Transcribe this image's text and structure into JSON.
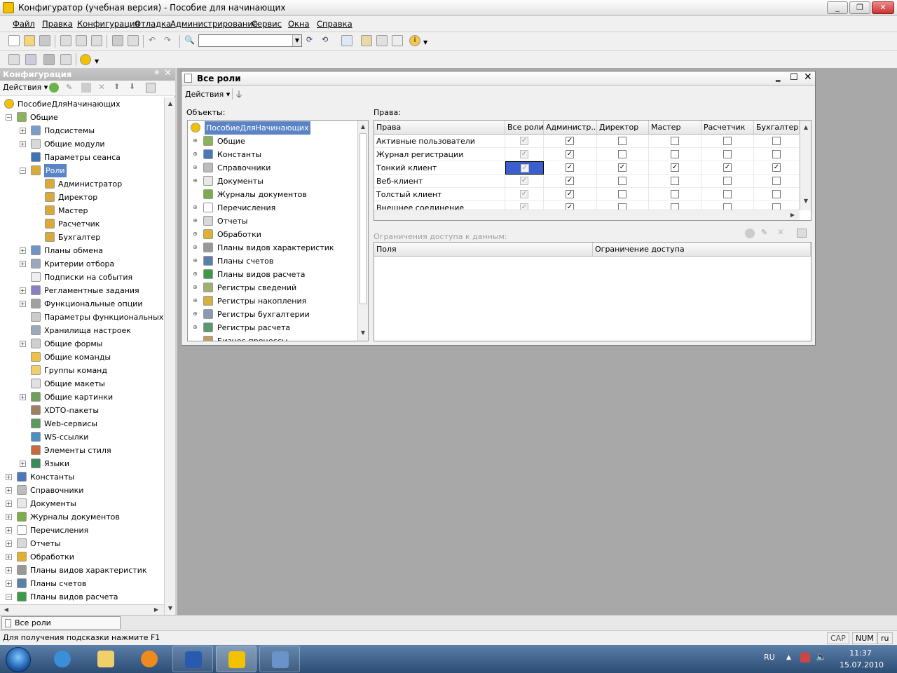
{
  "window": {
    "title": "Конфигуратор (учебная версия) - Пособие для начинающих"
  },
  "menu": [
    "Файл",
    "Правка",
    "Конфигурация",
    "Отладка",
    "Администрирование",
    "Сервис",
    "Окна",
    "Справка"
  ],
  "left_panel": {
    "title": "Конфигурация",
    "actions_label": "Действия",
    "tree": [
      {
        "label": "ПособиеДляНачинающих",
        "level": 0,
        "icon": "config-icon",
        "exp": ""
      },
      {
        "label": "Общие",
        "level": 1,
        "icon": "common-icon",
        "exp": "-"
      },
      {
        "label": "Подсистемы",
        "level": 2,
        "icon": "subsystems-icon",
        "exp": "+"
      },
      {
        "label": "Общие модули",
        "level": 2,
        "icon": "module-icon",
        "exp": "+"
      },
      {
        "label": "Параметры сеанса",
        "level": 2,
        "icon": "session-params-icon",
        "exp": ""
      },
      {
        "label": "Роли",
        "level": 2,
        "icon": "role-icon",
        "exp": "-",
        "selected": true
      },
      {
        "label": "Администратор",
        "level": 3,
        "icon": "role-icon",
        "exp": ""
      },
      {
        "label": "Директор",
        "level": 3,
        "icon": "role-icon",
        "exp": ""
      },
      {
        "label": "Мастер",
        "level": 3,
        "icon": "role-icon",
        "exp": ""
      },
      {
        "label": "Расчетчик",
        "level": 3,
        "icon": "role-icon",
        "exp": ""
      },
      {
        "label": "Бухгалтер",
        "level": 3,
        "icon": "role-icon",
        "exp": ""
      },
      {
        "label": "Планы обмена",
        "level": 2,
        "icon": "exchange-plan-icon",
        "exp": "+"
      },
      {
        "label": "Критерии отбора",
        "level": 2,
        "icon": "filter-criteria-icon",
        "exp": "+"
      },
      {
        "label": "Подписки на события",
        "level": 2,
        "icon": "event-sub-icon",
        "exp": ""
      },
      {
        "label": "Регламентные задания",
        "level": 2,
        "icon": "scheduled-jobs-icon",
        "exp": "+"
      },
      {
        "label": "Функциональные опции",
        "level": 2,
        "icon": "func-options-icon",
        "exp": "+"
      },
      {
        "label": "Параметры функциональных опций",
        "level": 2,
        "icon": "func-params-icon",
        "exp": ""
      },
      {
        "label": "Хранилища настроек",
        "level": 2,
        "icon": "settings-storage-icon",
        "exp": ""
      },
      {
        "label": "Общие формы",
        "level": 2,
        "icon": "form-icon",
        "exp": "+"
      },
      {
        "label": "Общие команды",
        "level": 2,
        "icon": "command-icon",
        "exp": ""
      },
      {
        "label": "Группы команд",
        "level": 2,
        "icon": "folder-icon",
        "exp": ""
      },
      {
        "label": "Общие макеты",
        "level": 2,
        "icon": "template-icon",
        "exp": ""
      },
      {
        "label": "Общие картинки",
        "level": 2,
        "icon": "picture-icon",
        "exp": "+"
      },
      {
        "label": "XDTO-пакеты",
        "level": 2,
        "icon": "xdto-icon",
        "exp": ""
      },
      {
        "label": "Web-сервисы",
        "level": 2,
        "icon": "web-service-icon",
        "exp": ""
      },
      {
        "label": "WS-ссылки",
        "level": 2,
        "icon": "ws-link-icon",
        "exp": ""
      },
      {
        "label": "Элементы стиля",
        "level": 2,
        "icon": "style-icon",
        "exp": ""
      },
      {
        "label": "Языки",
        "level": 2,
        "icon": "language-icon",
        "exp": "+"
      },
      {
        "label": "Константы",
        "level": 1,
        "icon": "constants-icon",
        "exp": "+"
      },
      {
        "label": "Справочники",
        "level": 1,
        "icon": "catalog-icon",
        "exp": "+"
      },
      {
        "label": "Документы",
        "level": 1,
        "icon": "document-icon",
        "exp": "+"
      },
      {
        "label": "Журналы документов",
        "level": 1,
        "icon": "journal-icon",
        "exp": "+"
      },
      {
        "label": "Перечисления",
        "level": 1,
        "icon": "enum-icon",
        "exp": "+"
      },
      {
        "label": "Отчеты",
        "level": 1,
        "icon": "report-icon",
        "exp": "+"
      },
      {
        "label": "Обработки",
        "level": 1,
        "icon": "dataprocessor-icon",
        "exp": "+"
      },
      {
        "label": "Планы видов характеристик",
        "level": 1,
        "icon": "chart-of-char-icon",
        "exp": "+"
      },
      {
        "label": "Планы счетов",
        "level": 1,
        "icon": "chart-of-accounts-icon",
        "exp": "+"
      },
      {
        "label": "Планы видов расчета",
        "level": 1,
        "icon": "chart-of-calc-icon",
        "exp": "-"
      }
    ]
  },
  "roles_window": {
    "title": "Все роли",
    "actions_label": "Действия",
    "objects_label": "Объекты:",
    "rights_label": "Права:",
    "objects": [
      {
        "label": "ПособиеДляНачинающих",
        "icon": "config-icon",
        "exp": "",
        "selected": true
      },
      {
        "label": "Общие",
        "icon": "common-icon",
        "exp": "+"
      },
      {
        "label": "Константы",
        "icon": "constants-icon",
        "exp": "+"
      },
      {
        "label": "Справочники",
        "icon": "catalog-icon",
        "exp": "+"
      },
      {
        "label": "Документы",
        "icon": "document-icon",
        "exp": "+"
      },
      {
        "label": "Журналы документов",
        "icon": "journal-icon",
        "exp": ""
      },
      {
        "label": "Перечисления",
        "icon": "enum-icon",
        "exp": "+"
      },
      {
        "label": "Отчеты",
        "icon": "report-icon",
        "exp": "+"
      },
      {
        "label": "Обработки",
        "icon": "dataprocessor-icon",
        "exp": "+"
      },
      {
        "label": "Планы видов характеристик",
        "icon": "chart-of-char-icon",
        "exp": "+"
      },
      {
        "label": "Планы счетов",
        "icon": "chart-of-accounts-icon",
        "exp": "+"
      },
      {
        "label": "Планы видов расчета",
        "icon": "chart-of-calc-icon",
        "exp": "+"
      },
      {
        "label": "Регистры сведений",
        "icon": "info-register-icon",
        "exp": "+"
      },
      {
        "label": "Регистры накопления",
        "icon": "accum-register-icon",
        "exp": "+"
      },
      {
        "label": "Регистры бухгалтерии",
        "icon": "account-register-icon",
        "exp": "+"
      },
      {
        "label": "Регистры расчета",
        "icon": "calc-register-icon",
        "exp": "+"
      },
      {
        "label": "Бизнес-процессы",
        "icon": "business-process-icon",
        "exp": ""
      }
    ],
    "rights_columns": [
      "Права",
      "Все роли",
      "Администр...",
      "Директор",
      "Мастер",
      "Расчетчик",
      "Бухгалтер"
    ],
    "rights_rows": [
      {
        "name": "Активные пользователи",
        "all": true,
        "values": [
          true,
          false,
          false,
          false,
          false
        ]
      },
      {
        "name": "Журнал регистрации",
        "all": true,
        "values": [
          true,
          false,
          false,
          false,
          false
        ]
      },
      {
        "name": "Тонкий клиент",
        "all": true,
        "values": [
          true,
          true,
          true,
          true,
          true
        ],
        "selected": true
      },
      {
        "name": "Веб-клиент",
        "all": true,
        "values": [
          true,
          false,
          false,
          false,
          false
        ]
      },
      {
        "name": "Толстый клиент",
        "all": true,
        "values": [
          true,
          false,
          false,
          false,
          false
        ]
      },
      {
        "name": "Внешнее соединение",
        "all": true,
        "values": [
          true,
          false,
          false,
          false,
          false
        ]
      }
    ],
    "restrictions_label": "Ограничения доступа к данным:",
    "restrictions_columns": [
      "Поля",
      "Ограничение доступа"
    ]
  },
  "app_tabs": [
    "Все роли"
  ],
  "status": {
    "hint": "Для получения подсказки нажмите F1",
    "cap": "CAP",
    "num": "NUM",
    "lang": "ru"
  },
  "taskbar": {
    "lang": "RU",
    "time": "11:37",
    "date": "15.07.2010"
  },
  "colors": {
    "selection": "#5a84c6",
    "taskbar": "#2c4d74"
  }
}
